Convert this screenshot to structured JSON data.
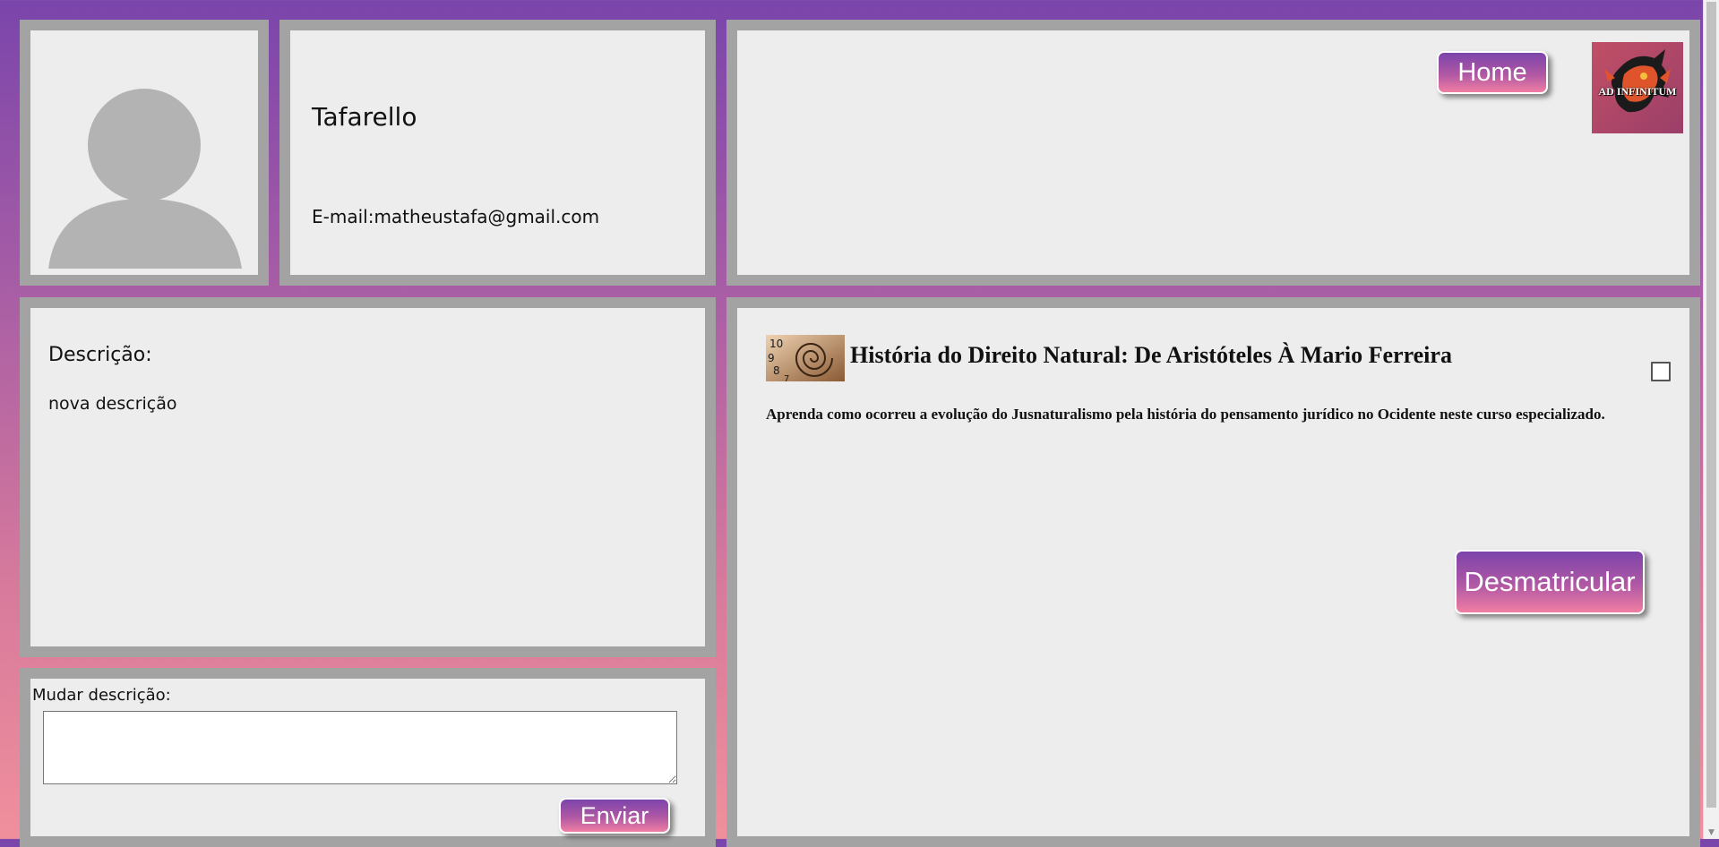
{
  "profile": {
    "name": "Tafarello",
    "email": "E-mail:matheustafa@gmail.com"
  },
  "header": {
    "home_label": "Home",
    "logo_text": "AD INFINITUM"
  },
  "description": {
    "title": "Descrição:",
    "text": "nova descrição"
  },
  "change_description": {
    "label": "Mudar descrição:",
    "textarea_value": "",
    "submit_label": "Enviar"
  },
  "course": {
    "title": "História do Direito Natural: De Aristóteles À Mario Ferreira",
    "description": "Aprenda como ocorreu a evolução do Jusnaturalismo pela história do pensamento jurídico no Ocidente neste curso especializado.",
    "checkbox_checked": false,
    "unenroll_label": "Desmatricular"
  },
  "colors": {
    "panel_bg": "#ededed",
    "panel_border": "#a3a3a3",
    "bg_top": "#7a45ab",
    "bg_bottom": "#f08f9c"
  }
}
